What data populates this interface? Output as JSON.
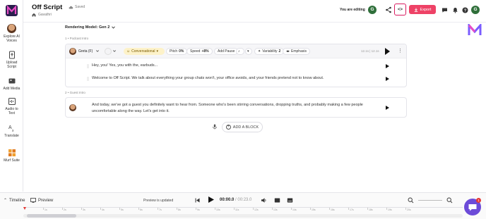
{
  "header": {
    "title": "Off Script",
    "saved": "Saved",
    "breadcrumb": "Gavathri",
    "editing": "You are editing",
    "user_initial": "G",
    "code_symbol": "<>",
    "export_label": "Export"
  },
  "sidebar": {
    "items": [
      {
        "label1": "Explore AI",
        "label2": "Voices",
        "icon": "avatar-icon"
      },
      {
        "label1": "Upload",
        "label2": "Script",
        "icon": "upload-script-icon"
      },
      {
        "label1": "Add Media",
        "label2": "",
        "icon": "media-icon"
      },
      {
        "label1": "Audio to",
        "label2": "Text",
        "icon": "audio-to-text-icon"
      },
      {
        "label1": "Translate",
        "label2": "",
        "icon": "translate-icon"
      },
      {
        "label1": "Murf Suite",
        "label2": "",
        "icon": "suite-icon"
      }
    ]
  },
  "editor": {
    "rendering_model": "Rendering Model: Gen 2",
    "section1": "1 • Podcast Intro",
    "section2": "2 • Guest Intro",
    "voice": "Greta (F)",
    "style": "Conversational",
    "pitch_label": "Pitch",
    "pitch_value": "0%",
    "speed_label": "Speed",
    "speed_value": "+8%",
    "add_pause": "Add Pause",
    "variability_label": "Variability",
    "variability_value": "2",
    "emphasis": "Emphasis",
    "time": "12.1s | 12.1s",
    "lines": [
      "Hey, you! Yes, you with the, earbuds...",
      "Welcome to Off Script. We talk about everything your group chats won't, your office avoids, and your friends pretend not to know about."
    ],
    "guest_text": "And today, we've got a guest you definitely want to hear from. Someone who's been stirring conversations, dropping truths, and probably making a few people uncomfortable along the way. Let's get into it.",
    "add_block": "ADD A BLOCK"
  },
  "timeline": {
    "timeline_label": "Timeline",
    "preview_label": "Preview",
    "preview_status": "Preview is updated",
    "current_time": "00:00.0",
    "duration": "00:23.0",
    "ticks": [
      "1s",
      "2s",
      "3s",
      "4s",
      "5s",
      "6s",
      "7s",
      "8s",
      "9s",
      "10s",
      "11s",
      "12s",
      "13s",
      "14s",
      "15s",
      "16s",
      "17s",
      "18s",
      "19s",
      "20s"
    ],
    "chat_badge": "1"
  },
  "colors": {
    "accent": "#ee4266",
    "code_border": "#d81b60",
    "style_pill": "#fdf2c9",
    "chat": "#6c4bd8"
  }
}
